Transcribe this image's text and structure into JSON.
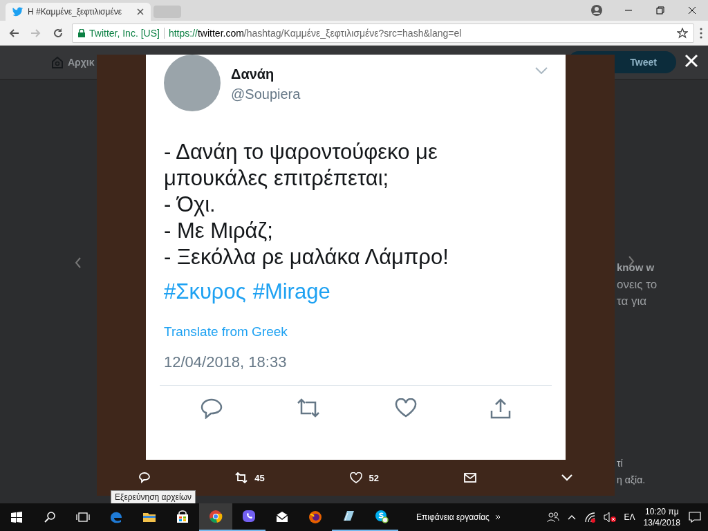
{
  "browser": {
    "tabs": [
      {
        "title": "Η #Καμμένε_ξεφτιλισμένε",
        "selected": true
      },
      {
        "selected": false
      }
    ],
    "address": {
      "secure_label": "Twitter, Inc. [US]",
      "url_scheme": "https://",
      "url_host": "twitter.com",
      "url_path": "/hashtag/Καμμένε_ξεφτιλισμένε?src=hash&lang=el"
    }
  },
  "page": {
    "nav_home": "Αρχικ",
    "tweet_button": "Tweet",
    "background_fragments": [
      {
        "text": "know w",
        "kind": "bold"
      },
      {
        "text": "ονεις το",
        "kind": "large"
      },
      {
        "text": "τα για",
        "kind": "large"
      },
      {
        "text": "τί",
        "kind": "plain"
      },
      {
        "text": "η αξία.",
        "kind": "plain"
      }
    ]
  },
  "modal": {
    "tweet": {
      "name": "Δανάη",
      "handle": "@Soupiera",
      "lines": [
        "- Δανάη το ψαροντούφεκο με",
        "μπουκάλες επιτρέπεται;",
        "- Όχι.",
        "- Με Μιράζ;",
        "- Ξεκόλλα ρε μαλάκα Λάμπρο!"
      ],
      "hashtags": [
        "#Σκυρος",
        "#Mirage"
      ],
      "translate": "Translate from Greek",
      "date": "12/04/2018, 18:33"
    },
    "actions": {
      "retweets": "45",
      "likes": "52"
    }
  },
  "tooltip": "Εξερεύνηση αρχείων",
  "taskbar": {
    "apps": [
      {
        "kind": "edge",
        "running": false,
        "selected": false
      },
      {
        "kind": "explorer",
        "running": false,
        "selected": false
      },
      {
        "kind": "store",
        "running": false,
        "selected": false
      },
      {
        "kind": "chrome",
        "running": true,
        "selected": true
      },
      {
        "kind": "viber",
        "running": true,
        "selected": false
      },
      {
        "kind": "mail",
        "running": false,
        "selected": false
      },
      {
        "kind": "firefox",
        "running": false,
        "selected": false
      },
      {
        "kind": "notes",
        "running": true,
        "selected": false
      },
      {
        "kind": "skype",
        "running": true,
        "selected": false
      }
    ],
    "desktop_label": "Επιφάνεια εργασίας",
    "language": "ΕΛ",
    "time": "10:20 πμ",
    "date": "13/4/2018"
  }
}
